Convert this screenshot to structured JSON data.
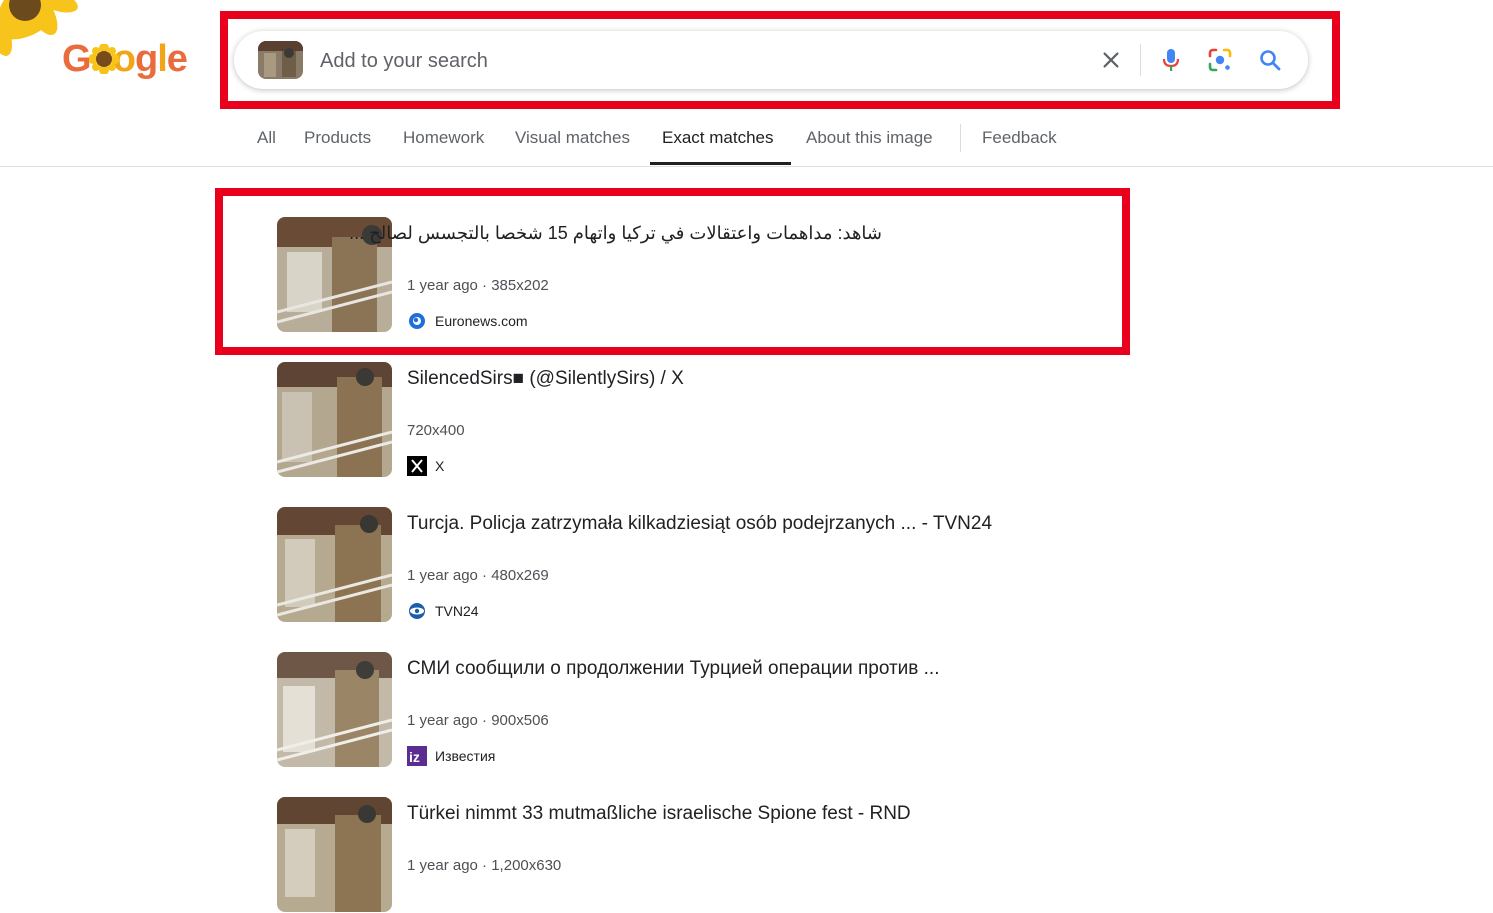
{
  "logo": {
    "letters": [
      "G",
      "o",
      "o",
      "g",
      "l",
      "e"
    ]
  },
  "search": {
    "placeholder": "Add to your search",
    "icons": [
      "clear-icon",
      "mic-icon",
      "lens-icon",
      "search-icon"
    ]
  },
  "tabs": [
    {
      "label": "All"
    },
    {
      "label": "Products"
    },
    {
      "label": "Homework"
    },
    {
      "label": "Visual matches"
    },
    {
      "label": "Exact matches"
    },
    {
      "label": "About this image"
    },
    {
      "label": "Feedback"
    }
  ],
  "active_tab": "Exact matches",
  "results": [
    {
      "title": "شاهد: مداهمات واعتقالات في تركيا واتهام 15 شخصا بالتجسس لصالح ...",
      "meta": "1 year ago · 385x202",
      "source": "Euronews.com"
    },
    {
      "title": "SilencedSirs■ (@SilentlySirs) / X",
      "meta": "720x400",
      "source": "X"
    },
    {
      "title": "Turcja. Policja zatrzymała kilkadziesiąt osób podejrzanych ... - TVN24",
      "meta": "1 year ago · 480x269",
      "source": "TVN24"
    },
    {
      "title": "СМИ сообщили о продолжении Турцией операции против ...",
      "meta": "1 year ago · 900x506",
      "source": "Известия"
    },
    {
      "title": "Türkei nimmt 33 mutmaßliche israelische Spione fest - RND",
      "meta": "1 year ago · 1,200x630",
      "source": ""
    }
  ],
  "colors": {
    "highlight": "#e8001c",
    "blue": "#4285f4",
    "red": "#ea4335",
    "yellow": "#fbbc05",
    "green": "#34a853"
  }
}
